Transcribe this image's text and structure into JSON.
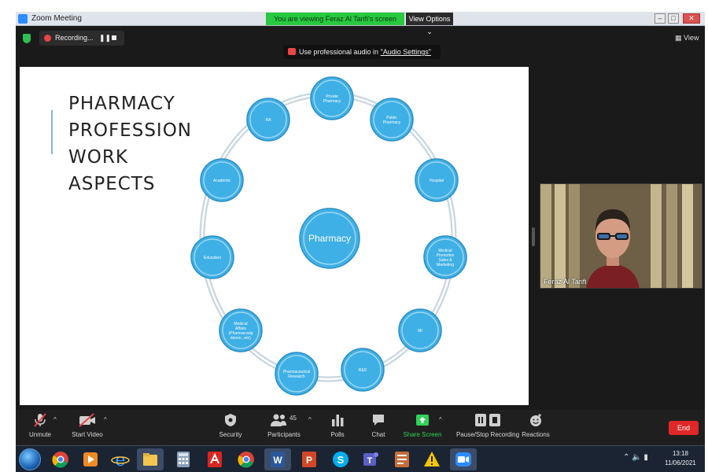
{
  "window": {
    "title": "Zoom Meeting",
    "viewing_banner": "You are viewing Feraz Al Tarifi's screen",
    "view_options": "View Options ⌄",
    "controls": {
      "minimize": "–",
      "maximize": "□",
      "close": "✕"
    }
  },
  "status_bar": {
    "recording_label": "Recording...",
    "pause_glyph": "❚❚",
    "audio_notice_prefix": "Use professional audio in ",
    "audio_notice_link": "\"Audio Settings\"",
    "view_label": "View",
    "shield_icon": "shield-icon"
  },
  "slide": {
    "title_lines": [
      "PHARMACY",
      "PROFESSION",
      "WORK ASPECTS"
    ],
    "center": "Pharmacy",
    "nodes": [
      {
        "id": "n0",
        "label_lines": [
          "Private",
          "Pharmacy"
        ]
      },
      {
        "id": "n1",
        "label_lines": [
          "Public",
          "Pharmacy"
        ]
      },
      {
        "id": "n2",
        "label_lines": [
          "Hospital"
        ]
      },
      {
        "id": "n3",
        "label_lines": [
          "Medical",
          "Promotion",
          "Sales &",
          "Marketing"
        ]
      },
      {
        "id": "n4",
        "label_lines": [
          "MI"
        ]
      },
      {
        "id": "n5",
        "label_lines": [
          "R&D"
        ]
      },
      {
        "id": "n6",
        "label_lines": [
          "Pharmaceutical",
          "Research"
        ]
      },
      {
        "id": "n7",
        "label_lines": [
          "Medical",
          "Affairs",
          "(Pharmacovig",
          "ilance...etc)"
        ]
      },
      {
        "id": "n8",
        "label_lines": [
          "Education"
        ]
      },
      {
        "id": "n9",
        "label_lines": [
          "Academic"
        ]
      },
      {
        "id": "n10",
        "label_lines": [
          "RA"
        ]
      }
    ]
  },
  "participant": {
    "name": "Feraz Al Tarifi"
  },
  "toolbar": {
    "unmute": "Unmute",
    "start_video": "Start Video",
    "security": "Security",
    "participants": "Participants",
    "participant_count": "45",
    "polls": "Polls",
    "chat": "Chat",
    "share_screen": "Share Screen",
    "pause_recording": "Pause/Stop Recording",
    "reactions": "Reactions",
    "end": "End",
    "caret": "^",
    "colors": {
      "end": "#e02828",
      "share": "#31d158"
    }
  },
  "taskbar": {
    "apps": [
      "windows-start-icon",
      "chrome-icon",
      "media-player-icon",
      "internet-explorer-icon",
      "file-explorer-icon",
      "calculator-icon",
      "acrobat-icon",
      "chrome-icon",
      "word-icon",
      "powerpoint-icon",
      "skype-icon",
      "teams-icon",
      "onenote-icon",
      "warning-icon",
      "zoom-icon"
    ],
    "tray": "⌃ 🔈 ▮",
    "time": "13:18",
    "date": "11/06/2021"
  }
}
